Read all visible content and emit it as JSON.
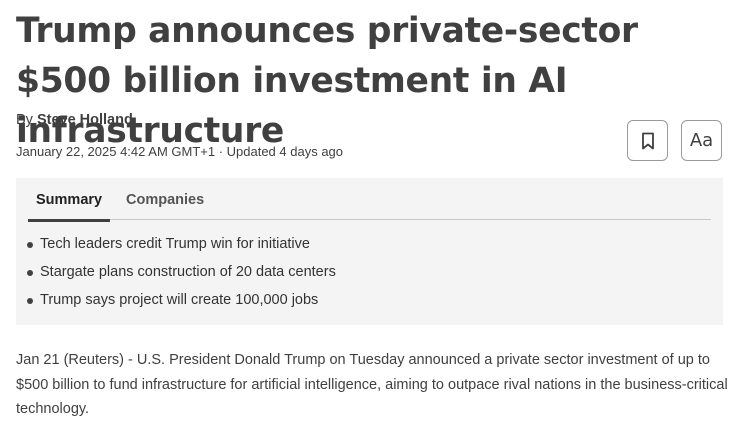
{
  "article": {
    "headline": "Trump announces private-sector $500 billion investment in AI infrastructure",
    "byline_prefix": "By ",
    "author": "Steve Holland",
    "dateline": "January 22, 2025 4:42 AM GMT+1 · Updated 4 days ago",
    "body": "Jan 21 (Reuters) - U.S. President Donald Trump on Tuesday announced a private sector investment of up to $500 billion to fund infrastructure for artificial intelligence, aiming to outpace rival nations in the business-critical technology."
  },
  "toolbar": {
    "bookmark_icon": "bookmark-icon",
    "font_size_label": "Aa"
  },
  "summary": {
    "tabs": [
      "Summary",
      "Companies"
    ],
    "active_tab": "Summary",
    "bullets": [
      "Tech leaders credit Trump win for initiative",
      "Stargate plans construction of 20 data centers",
      "Trump says project will create 100,000 jobs"
    ]
  },
  "colors": {
    "text": "#404040",
    "summary_background": "#f4f4f4",
    "button_border": "#9a9a9a"
  }
}
